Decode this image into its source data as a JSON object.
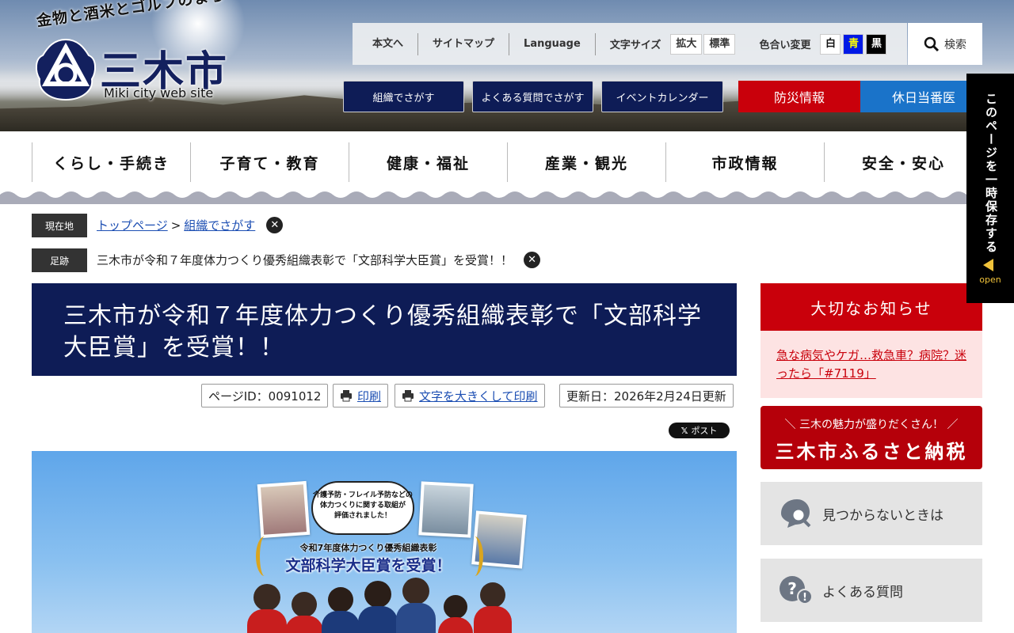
{
  "header": {
    "tagline": "金物と酒米とゴルフのまち",
    "logo_name": "三木市",
    "logo_sub": "Miki city web site",
    "utility": {
      "links": [
        "本文へ",
        "サイトマップ",
        "Language"
      ],
      "font_size_label": "文字サイズ",
      "size_large": "拡大",
      "size_standard": "標準",
      "color_label": "色合い変更",
      "color_white": "白",
      "color_blue": "青",
      "color_black": "黒",
      "search": "検索"
    },
    "nav_buttons": [
      "組織でさがす",
      "よくある質問でさがす",
      "イベントカレンダー"
    ],
    "bousai": "防災情報",
    "kyujitsu": "休日当番医"
  },
  "global_nav": [
    "くらし・手続き",
    "子育て・教育",
    "健康・福祉",
    "産業・観光",
    "市政情報",
    "安全・安心"
  ],
  "breadcrumb": {
    "current_label": "現在地",
    "top": "トップページ",
    "sep": ">",
    "section": "組織でさがす",
    "history_label": "足跡",
    "history_item": "三木市が令和７年度体力つくり優秀組織表彰で「文部科学大臣賞」を受賞！！"
  },
  "main": {
    "title": "三木市が令和７年度体力つくり優秀組織表彰で「文部科学大臣賞」を受賞！！",
    "page_id": "ページID：0091012",
    "print": "印刷",
    "print_large": "文字を大きくして印刷",
    "updated": "更新日：2026年2月24日更新",
    "x_post": "ポスト",
    "hero": {
      "caption1": "介護予防・フレイル予防などの",
      "caption2": "体力つくりに関する取組が",
      "caption3": "評価されました！",
      "award_line": "令和7年度体力つくり優秀組織表彰",
      "award_main": "文部科学大臣賞を受賞！"
    }
  },
  "sidebar": {
    "notice_title": "大切なお知らせ",
    "notice_link": "急な病気やケガ…救急車？病院？迷ったら「#7119」",
    "furusato_top": "＼ 三木の魅力が盛りだくさん！ ／",
    "furusato_main": "三木市ふるさと納税",
    "not_found": "見つからないときは",
    "faq": "よくある質問"
  },
  "save_tab": {
    "text": "このページを一時保存する",
    "open": "open"
  },
  "colors": {
    "navy": "#0e1c56",
    "red": "#c9000b",
    "blue": "#1a73c9",
    "color_blue_btn": "#0019e6",
    "color_blue_text": "#ffff00"
  }
}
